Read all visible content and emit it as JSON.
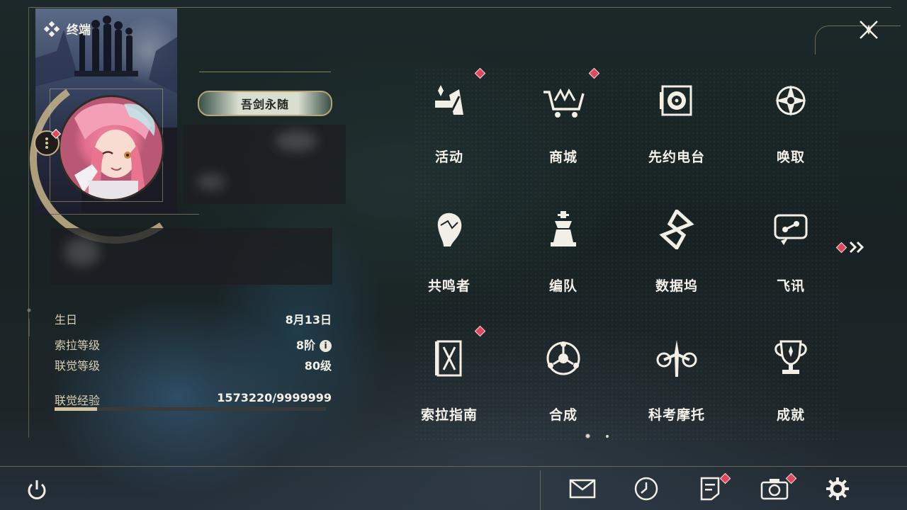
{
  "header": {
    "terminal_label": "终端"
  },
  "profile": {
    "title_badge": "吾剑永随",
    "stats": [
      {
        "label": "生日",
        "value": "8月13日"
      },
      {
        "label": "索拉等级",
        "value": "8阶"
      },
      {
        "label": "联觉等级",
        "value": "80级"
      },
      {
        "label": "联觉经验",
        "value": "1573220/9999999"
      }
    ],
    "exp_progress": 0.157
  },
  "menu": {
    "items": [
      {
        "label": "活动",
        "icon": "activity-icon",
        "badge": true
      },
      {
        "label": "商城",
        "icon": "shop-cart-icon",
        "badge": true
      },
      {
        "label": "先约电台",
        "icon": "radio-icon",
        "badge": false
      },
      {
        "label": "唤取",
        "icon": "convene-icon",
        "badge": false
      },
      {
        "label": "共鸣者",
        "icon": "resonator-icon",
        "badge": false
      },
      {
        "label": "编队",
        "icon": "team-chess-icon",
        "badge": false
      },
      {
        "label": "数据坞",
        "icon": "data-bank-icon",
        "badge": false
      },
      {
        "label": "飞讯",
        "icon": "message-icon",
        "badge": false
      },
      {
        "label": "索拉指南",
        "icon": "guidebook-icon",
        "badge": true
      },
      {
        "label": "合成",
        "icon": "synthesis-icon",
        "badge": false
      },
      {
        "label": "科考摩托",
        "icon": "motorbike-icon",
        "badge": false
      },
      {
        "label": "成就",
        "icon": "trophy-icon",
        "badge": false
      }
    ],
    "page_count": 2,
    "active_page": 1
  },
  "bottom_bar": {
    "icons": [
      "power-icon",
      "mail-icon",
      "clock-icon",
      "notes-icon",
      "camera-icon",
      "settings-gear-icon"
    ]
  },
  "colors": {
    "badge": "#e0475c",
    "gold": "#c8b48a",
    "text": "#f4f2ea"
  }
}
